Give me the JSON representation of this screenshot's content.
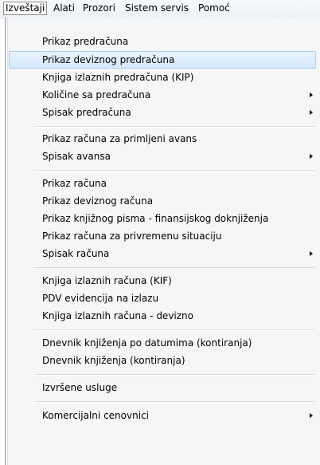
{
  "menubar": {
    "items": [
      "Izveštaji",
      "Alati",
      "Prozori",
      "Sistem servis",
      "Pomoć"
    ]
  },
  "dropdown": {
    "items": [
      "Prikaz predračuna",
      "Prikaz deviznog predračuna",
      "Knjiga izlaznih predračuna (KIP)",
      "Količine sa predračuna",
      "Spisak predračuna",
      "Prikaz računa za primljeni avans",
      "Spisak avansa",
      "Prikaz računa",
      "Prikaz deviznog računa",
      "Prikaz knjižnog pisma - finansijskog doknjiženja",
      "Prikaz računa za privremenu situaciju",
      "Spisak računa",
      "Knjiga izlaznih računa (KIF)",
      "PDV evidencija na izlazu",
      "Knjiga izlaznih računa - devizno",
      "Dnevnik knjiženja po datumima (kontiranja)",
      "Dnevnik knjiženja (kontiranja)",
      "Izvršene usluge",
      "Komercijalni cenovnici"
    ]
  },
  "highlight_color": "#d6e9fc"
}
